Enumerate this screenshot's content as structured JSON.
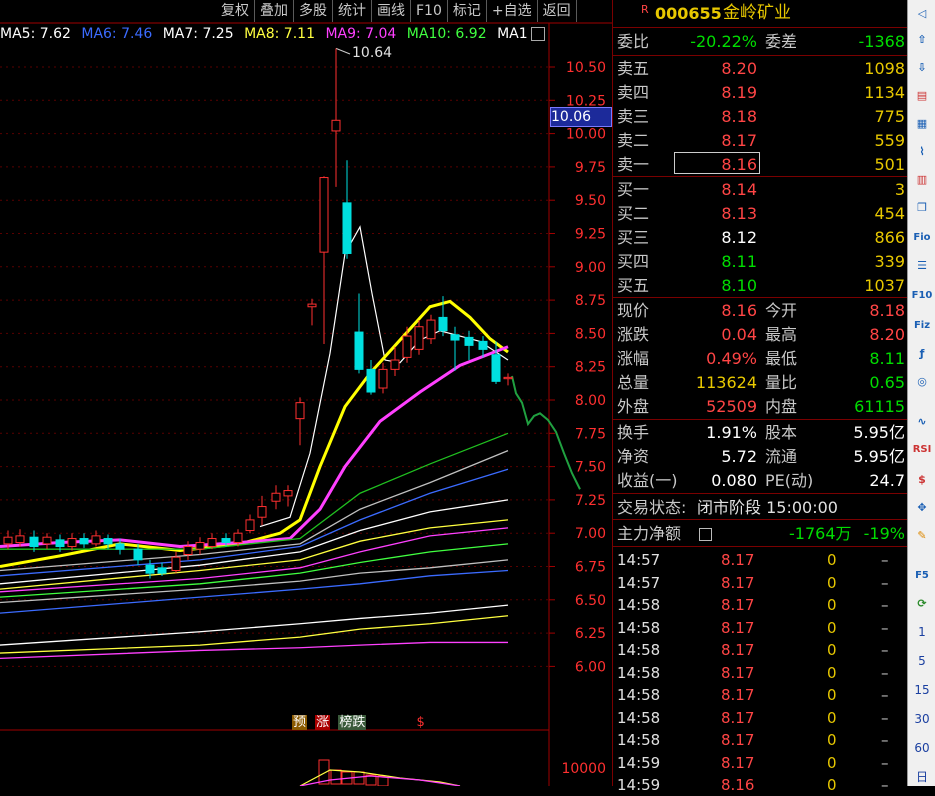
{
  "toolbar": [
    "复权",
    "叠加",
    "多股",
    "统计",
    "画线",
    "F10",
    "标记",
    "+自选",
    "返回"
  ],
  "ma_legend": [
    {
      "label": "MA5: 7.62",
      "color": "#ffffff"
    },
    {
      "label": "MA6: 7.46",
      "color": "#3b6bff"
    },
    {
      "label": "MA7: 7.25",
      "color": "#ffffff"
    },
    {
      "label": "MA8: 7.11",
      "color": "#ffff40"
    },
    {
      "label": "MA9: 7.04",
      "color": "#ff40ff"
    },
    {
      "label": "MA10: 6.92",
      "color": "#40ff40"
    },
    {
      "label": "MA1",
      "color": "#ffffff"
    }
  ],
  "price_axis": [
    "10.50",
    "10.25",
    "10.00",
    "9.75",
    "9.50",
    "9.25",
    "9.00",
    "8.75",
    "8.50",
    "8.25",
    "8.00",
    "7.75",
    "7.50",
    "7.25",
    "7.00",
    "6.75",
    "6.50",
    "6.25",
    "6.00"
  ],
  "volume_axis": [
    "10000"
  ],
  "high_marker": "10.64",
  "current_marker": "10.06",
  "badges": [
    "预",
    "涨",
    "榜跌",
    "$"
  ],
  "chart_data": {
    "type": "candlestick",
    "ylim": [
      6.0,
      10.6
    ],
    "high_label": "10.64",
    "crosshair_label": "10.06"
  },
  "stock": {
    "flag": "R",
    "code": "000655",
    "name": "金岭矿业"
  },
  "webi": {
    "l": "委比",
    "v": "-20.22%",
    "l2": "委差",
    "v2": "-1368"
  },
  "sells": [
    {
      "l": "卖五",
      "p": "8.20",
      "q": "1098"
    },
    {
      "l": "卖四",
      "p": "8.19",
      "q": "1134"
    },
    {
      "l": "卖三",
      "p": "8.18",
      "q": "775"
    },
    {
      "l": "卖二",
      "p": "8.17",
      "q": "559"
    },
    {
      "l": "卖一",
      "p": "8.16",
      "q": "501"
    }
  ],
  "buys": [
    {
      "l": "买一",
      "p": "8.14",
      "q": "3"
    },
    {
      "l": "买二",
      "p": "8.13",
      "q": "454"
    },
    {
      "l": "买三",
      "p": "8.12",
      "q": "866"
    },
    {
      "l": "买四",
      "p": "8.11",
      "q": "339"
    },
    {
      "l": "买五",
      "p": "8.10",
      "q": "1037"
    }
  ],
  "quote": [
    {
      "l": "现价",
      "v": "8.16",
      "l2": "今开",
      "v2": "8.18"
    },
    {
      "l": "涨跌",
      "v": "0.04",
      "l2": "最高",
      "v2": "8.20"
    },
    {
      "l": "涨幅",
      "v": "0.49%",
      "l2": "最低",
      "v2": "8.11"
    },
    {
      "l": "总量",
      "v": "113624",
      "l2": "量比",
      "v2": "0.65"
    },
    {
      "l": "外盘",
      "v": "52509",
      "l2": "内盘",
      "v2": "61115"
    }
  ],
  "fund": [
    {
      "l": "换手",
      "v": "1.91%",
      "l2": "股本",
      "v2": "5.95亿"
    },
    {
      "l": "净资",
      "v": "5.72",
      "l2": "流通",
      "v2": "5.95亿"
    },
    {
      "l": "收益(一)",
      "v": "0.080",
      "l2": "PE(动)",
      "v2": "24.7"
    }
  ],
  "status": {
    "label": "交易状态:",
    "value": "闭市阶段 15:00:00"
  },
  "main_flow": {
    "label": "主力净额",
    "value": "-1764万",
    "pct": "-19%"
  },
  "ticks": [
    {
      "t": "14:57",
      "p": "8.17",
      "q": "0",
      "d": "–"
    },
    {
      "t": "14:57",
      "p": "8.17",
      "q": "0",
      "d": "–"
    },
    {
      "t": "14:58",
      "p": "8.17",
      "q": "0",
      "d": "–"
    },
    {
      "t": "14:58",
      "p": "8.17",
      "q": "0",
      "d": "–"
    },
    {
      "t": "14:58",
      "p": "8.17",
      "q": "0",
      "d": "–"
    },
    {
      "t": "14:58",
      "p": "8.17",
      "q": "0",
      "d": "–"
    },
    {
      "t": "14:58",
      "p": "8.17",
      "q": "0",
      "d": "–"
    },
    {
      "t": "14:58",
      "p": "8.17",
      "q": "0",
      "d": "–"
    },
    {
      "t": "14:58",
      "p": "8.17",
      "q": "0",
      "d": "–"
    },
    {
      "t": "14:59",
      "p": "8.17",
      "q": "0",
      "d": "–"
    },
    {
      "t": "14:59",
      "p": "8.16",
      "q": "0",
      "d": "–"
    }
  ],
  "sidebar_numbers": [
    "1",
    "5",
    "15",
    "30",
    "60",
    "日"
  ],
  "sidebar_icons": [
    "Fio",
    "F10",
    "Fiz",
    "F5",
    "RSI"
  ]
}
